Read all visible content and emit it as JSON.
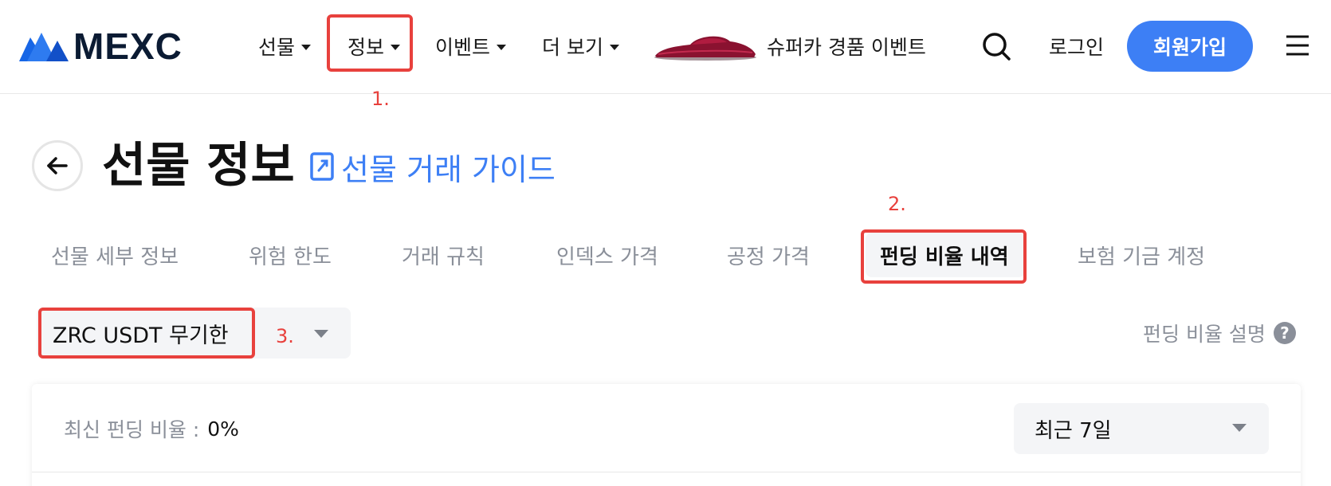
{
  "header": {
    "logo_text": "MEXC",
    "nav": [
      {
        "label": "선물"
      },
      {
        "label": "정보"
      },
      {
        "label": "이벤트"
      },
      {
        "label": "더 보기"
      }
    ],
    "promo_text": "슈퍼카 경품 이벤트",
    "login_label": "로그인",
    "signup_label": "회원가입",
    "icons": {
      "search": "search-icon",
      "menu": "hamburger-menu-icon",
      "promo": "supercar-image"
    }
  },
  "annotations": {
    "one": "1.",
    "two": "2.",
    "three": "3."
  },
  "page": {
    "title": "선물 정보",
    "guide_link": "선물 거래 가이드"
  },
  "tabs": [
    {
      "label": "선물 세부 정보"
    },
    {
      "label": "위험 한도"
    },
    {
      "label": "거래 규칙"
    },
    {
      "label": "인덱스 가격"
    },
    {
      "label": "공정 가격"
    },
    {
      "label": "펀딩 비율 내역",
      "active": true
    },
    {
      "label": "보험 기금 계정"
    }
  ],
  "contract_select": {
    "value": "ZRC USDT 무기한"
  },
  "funding_explain": "펀딩 비율 설명",
  "help_glyph": "?",
  "panel": {
    "latest_label": "최신 펀딩 비율 :",
    "latest_value": "0%",
    "period_value": "최근 7일"
  },
  "colors": {
    "accent": "#3d7ff5",
    "annotation": "#e8413d",
    "muted": "#8a8f99"
  }
}
